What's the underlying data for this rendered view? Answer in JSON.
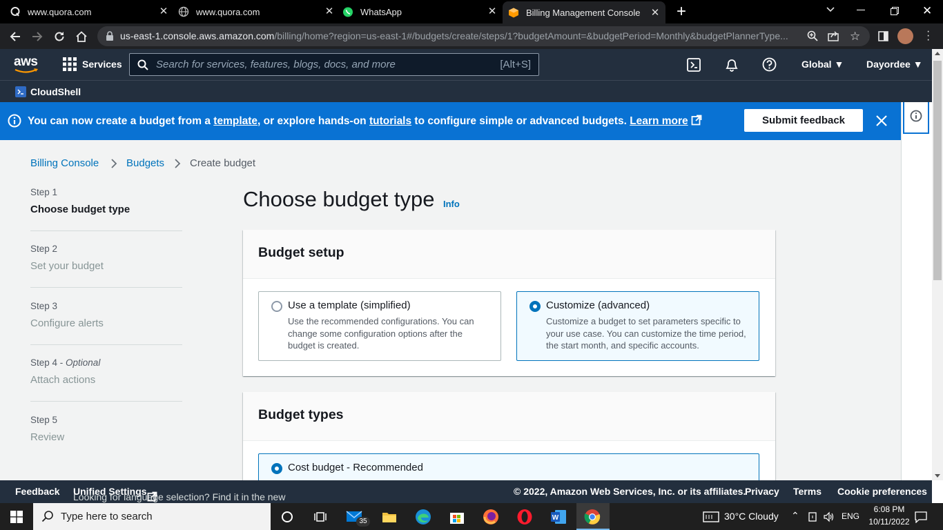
{
  "browser": {
    "tabs": [
      {
        "title": "www.quora.com",
        "icon": "quora-icon"
      },
      {
        "title": "www.quora.com",
        "icon": "globe-icon"
      },
      {
        "title": "WhatsApp",
        "icon": "whatsapp-icon"
      },
      {
        "title": "Billing Management Console",
        "icon": "aws-cube-icon",
        "active": true
      }
    ],
    "url_domain": "us-east-1.console.aws.amazon.com",
    "url_path": "/billing/home?region=us-east-1#/budgets/create/steps/1?budgetAmount=&budgetPeriod=Monthly&budgetPlannerType..."
  },
  "aws_nav": {
    "logo": "aws",
    "services_label": "Services",
    "search_placeholder": "Search for services, features, blogs, docs, and more",
    "search_shortcut": "[Alt+S]",
    "region": "Global",
    "user": "Dayordee",
    "cloudshell_label": "CloudShell"
  },
  "flash": {
    "text_1": "You can now create a budget from a ",
    "link_template": "template",
    "text_2": ", or explore hands-on ",
    "link_tutorials": "tutorials",
    "text_3": " to configure simple or advanced budgets. ",
    "link_learn": "Learn more",
    "feedback_button": "Submit feedback"
  },
  "breadcrumbs": [
    "Billing Console",
    "Budgets",
    "Create budget"
  ],
  "steps": [
    {
      "label": "Step 1",
      "name": "Choose budget type",
      "current": true
    },
    {
      "label": "Step 2",
      "name": "Set your budget"
    },
    {
      "label": "Step 3",
      "name": "Configure alerts"
    },
    {
      "label": "Step 4",
      "optional": "Optional",
      "name": "Attach actions"
    },
    {
      "label": "Step 5",
      "name": "Review"
    }
  ],
  "page": {
    "title": "Choose budget type",
    "info_link": "Info"
  },
  "budget_setup": {
    "heading": "Budget setup",
    "options": [
      {
        "title": "Use a template (simplified)",
        "desc": "Use the recommended configurations. You can change some configuration options after the budget is created.",
        "selected": false
      },
      {
        "title": "Customize (advanced)",
        "desc": "Customize a budget to set parameters specific to your use case. You can customize the time period, the start month, and specific accounts.",
        "selected": true
      }
    ]
  },
  "budget_types": {
    "heading": "Budget types",
    "first_option": "Cost budget - Recommended"
  },
  "footer": {
    "feedback": "Feedback",
    "lang_text": "Looking for language selection? Find it in the new ",
    "unified_settings": "Unified Settings",
    "copyright": "© 2022, Amazon Web Services, Inc. or its affiliates.",
    "privacy": "Privacy",
    "terms": "Terms",
    "cookie": "Cookie preferences"
  },
  "taskbar": {
    "search_placeholder": "Type here to search",
    "mail_badge": "35",
    "weather": "30°C  Cloudy",
    "lang": "ENG",
    "time": "6:08 PM",
    "date": "10/11/2022"
  },
  "colors": {
    "aws_nav": "#232f3e",
    "flash_blue": "#0972d3",
    "link_blue": "#0073bb",
    "aws_orange": "#ff9900"
  }
}
